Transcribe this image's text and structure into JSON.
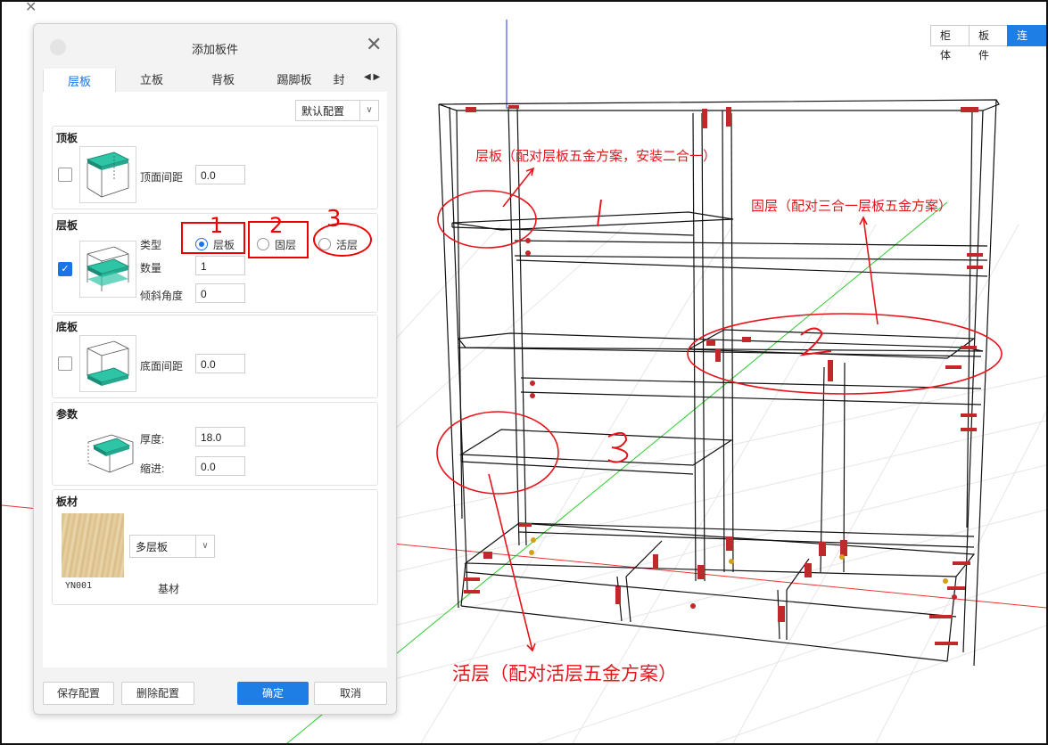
{
  "viewbar": [
    "柜体",
    "板件",
    "连接"
  ],
  "dialog": {
    "title": "添加板件",
    "tabs": [
      "层板",
      "立板",
      "背板",
      "踢脚板",
      "封"
    ],
    "config_select": "默认配置",
    "top_panel": {
      "title": "顶板",
      "label": "顶面间距",
      "value": "0.0"
    },
    "shelf": {
      "title": "层板",
      "type_label": "类型",
      "options": [
        "层板",
        "固层",
        "活层"
      ],
      "count_label": "数量",
      "count": "1",
      "tilt_label": "倾斜角度",
      "tilt": "0"
    },
    "bottom_panel": {
      "title": "底板",
      "label": "底面间距",
      "value": "0.0"
    },
    "params": {
      "title": "参数",
      "thickness_label": "厚度:",
      "thickness": "18.0",
      "inset_label": "缩进:",
      "inset": "0.0"
    },
    "material": {
      "title": "板材",
      "select": "多层板",
      "code": "YN001",
      "base_label": "基材"
    },
    "buttons": {
      "save": "保存配置",
      "delete": "删除配置",
      "ok": "确定",
      "cancel": "取消"
    },
    "hand_numbers": [
      "1",
      "2",
      "3"
    ]
  },
  "annotations": {
    "shelf_note": "层板（配对层板五金方案，安装二合一）",
    "fixed_note": "固层（配对三合一层板五金方案）",
    "movable_note": "活层（配对活层五金方案）",
    "hand_1": "1",
    "hand_2": "2",
    "hand_3": "3"
  },
  "colors": {
    "accent": "#1a73e8",
    "annotation": "#e8141c",
    "teal": "#2ec4a6"
  }
}
